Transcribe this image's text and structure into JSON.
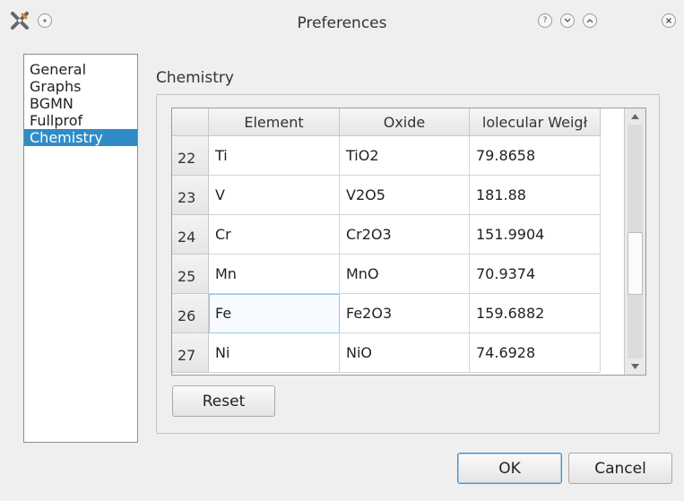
{
  "window": {
    "title": "Preferences",
    "controls": {
      "help": "?",
      "minimize": "⌄",
      "maximize": "⌃",
      "close": "×"
    }
  },
  "sidebar": {
    "items": [
      {
        "label": "General",
        "selected": false
      },
      {
        "label": "Graphs",
        "selected": false
      },
      {
        "label": "BGMN",
        "selected": false
      },
      {
        "label": "Fullprof",
        "selected": false
      },
      {
        "label": "Chemistry",
        "selected": true
      }
    ]
  },
  "chemistry": {
    "group_title": "Chemistry",
    "table": {
      "columns": [
        "Element",
        "Oxide",
        "lolecular Weigł"
      ],
      "rows": [
        {
          "num": "22",
          "element": "Ti",
          "oxide": "TiO2",
          "weight": "79.8658"
        },
        {
          "num": "23",
          "element": "V",
          "oxide": "V2O5",
          "weight": "181.88"
        },
        {
          "num": "24",
          "element": "Cr",
          "oxide": "Cr2O3",
          "weight": "151.9904"
        },
        {
          "num": "25",
          "element": "Mn",
          "oxide": "MnO",
          "weight": "70.9374"
        },
        {
          "num": "26",
          "element": "Fe",
          "oxide": "Fe2O3",
          "weight": "159.6882"
        },
        {
          "num": "27",
          "element": "Ni",
          "oxide": "NiO",
          "weight": "74.6928"
        }
      ]
    },
    "reset_label": "Reset"
  },
  "footer": {
    "ok_label": "OK",
    "cancel_label": "Cancel"
  },
  "colors": {
    "selection": "#308cc6",
    "default_button_border": "#4a90c8"
  },
  "icons": {
    "app": "scissors-x-icon",
    "pin": "pin-circle-icon",
    "scroll_up": "arrow-up-icon",
    "scroll_down": "arrow-down-icon"
  }
}
